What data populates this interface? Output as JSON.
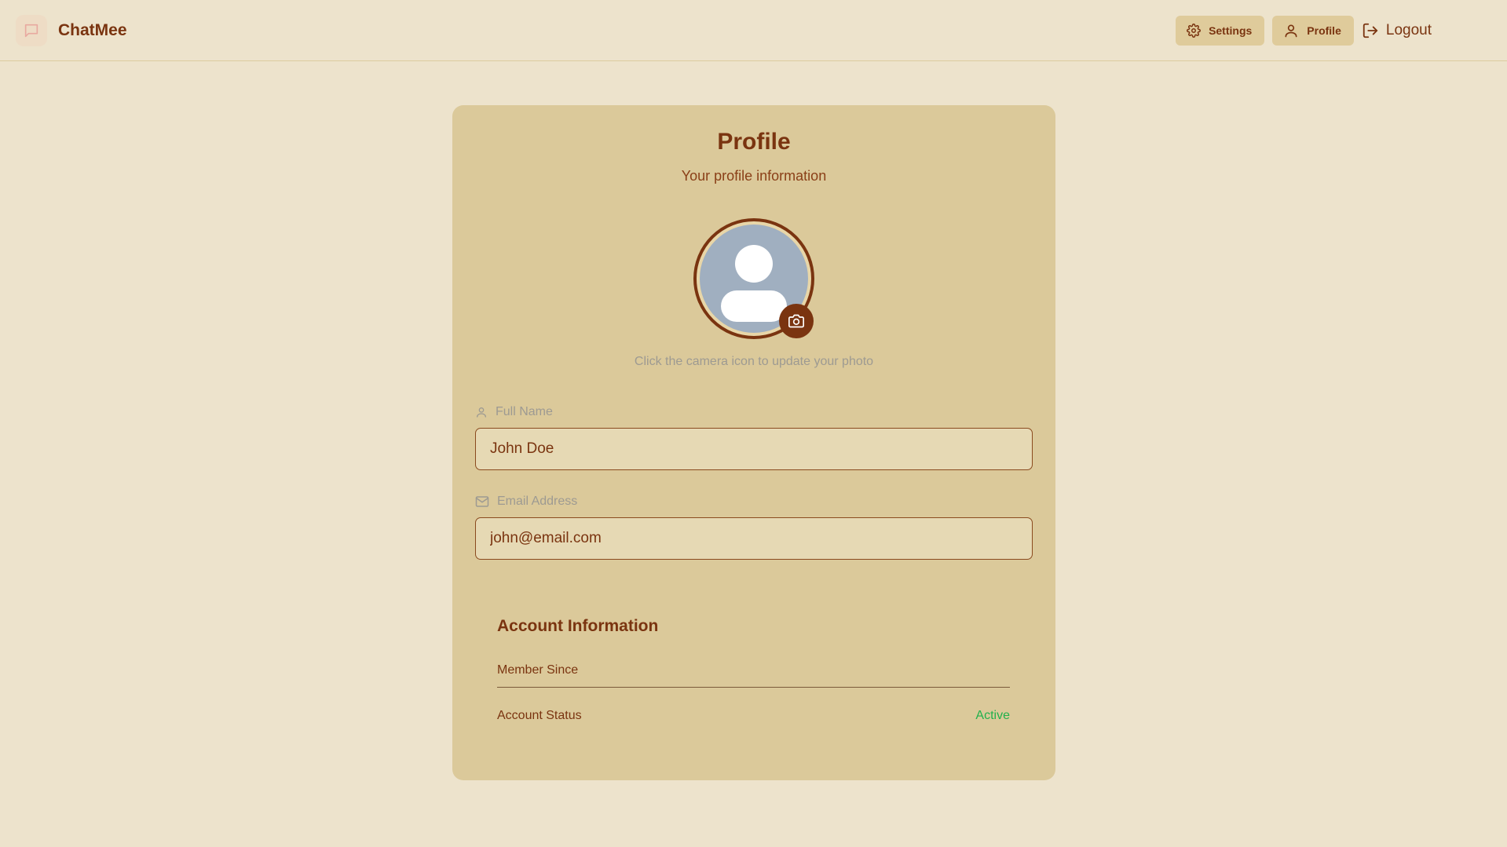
{
  "app": {
    "name": "ChatMee",
    "logo_icon": "message-square-icon"
  },
  "nav": {
    "settings_label": "Settings",
    "settings_icon": "gear-icon",
    "profile_label": "Profile",
    "profile_icon": "user-icon",
    "logout_label": "Logout",
    "logout_icon": "logout-icon"
  },
  "profile": {
    "title": "Profile",
    "subtitle": "Your profile information",
    "avatar_icon": "default-avatar-icon",
    "camera_icon": "camera-icon",
    "photo_hint": "Click the camera icon to update your photo",
    "full_name": {
      "label": "Full Name",
      "icon": "user-icon",
      "value": "John Doe"
    },
    "email": {
      "label": "Email Address",
      "icon": "mail-icon",
      "value": "john@email.com"
    }
  },
  "account": {
    "title": "Account Information",
    "member_since_label": "Member Since",
    "member_since_value": "",
    "status_label": "Account Status",
    "status_value": "Active"
  },
  "colors": {
    "page_bg": "#ede3cc",
    "card_bg": "#dbc99a",
    "accent": "#7a3410",
    "status_active": "#22b14c"
  }
}
